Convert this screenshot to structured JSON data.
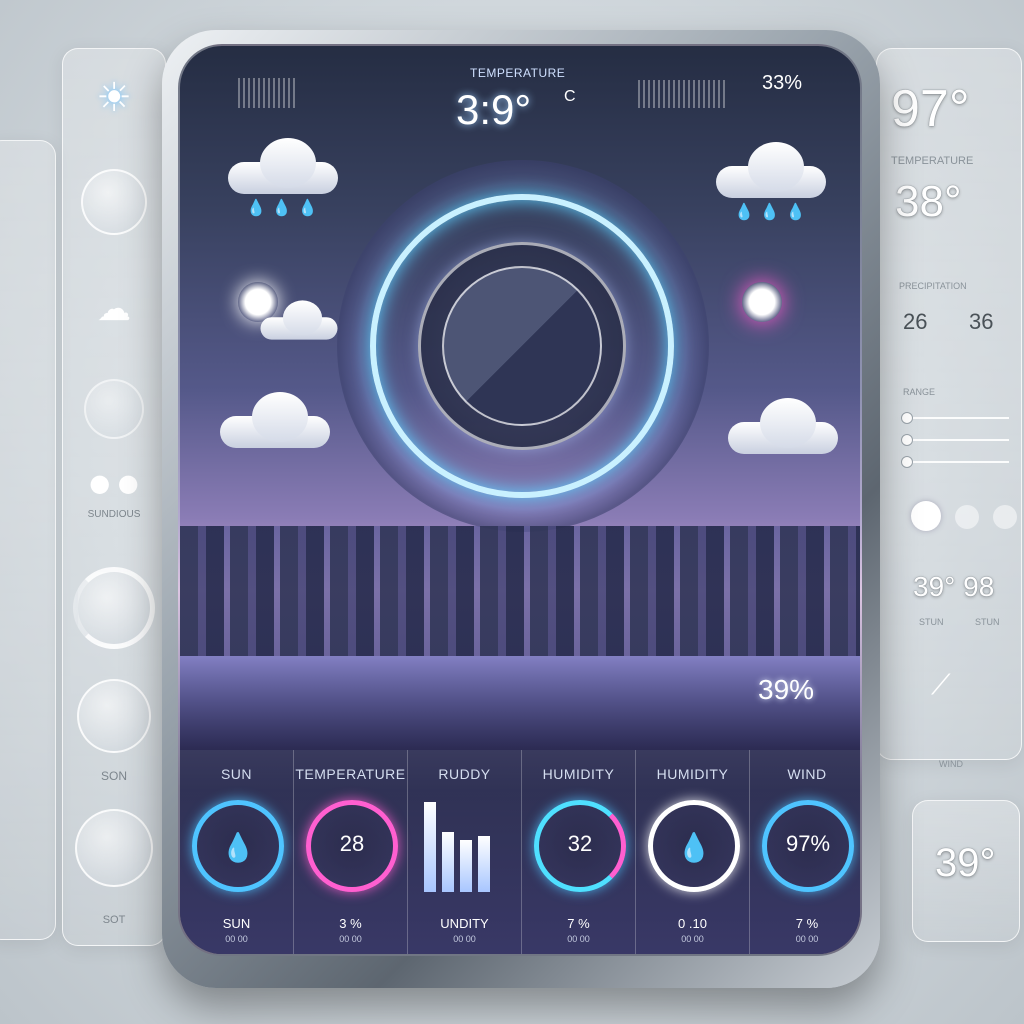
{
  "left_panel": {
    "side_label_1": "SON",
    "side_label_2": "SOT",
    "caption": "SUNDIOUS"
  },
  "right_panel": {
    "temp_top": "97°",
    "temperature_label": "TEMPERATURE",
    "temp_main": "38°",
    "small_label": "PRECIPITATION",
    "stat_a": "26",
    "stat_b": "36",
    "range_label": "RANGE",
    "pair_value": "39° 98",
    "pair_label_a": "STUN",
    "pair_label_b": "STUN",
    "wind_label": "WIND",
    "card_temp": "39°"
  },
  "screen": {
    "header_label": "TEMPERATURE",
    "header_temp": "3:9°",
    "header_unit": "C",
    "header_percent": "33%",
    "city_readout": "39%"
  },
  "stats": [
    {
      "label": "SUN",
      "value": "",
      "sub": "SUN",
      "sub2": "00 00"
    },
    {
      "label": "TEMPERATURE",
      "value": "28",
      "sub": "3 %",
      "sub2": "00 00"
    },
    {
      "label": "RUDDY",
      "value": "",
      "sub": "UNDITY",
      "sub2": "00 00"
    },
    {
      "label": "HUMIDITY",
      "value": "32",
      "sub": "7 %",
      "sub2": "00 00"
    },
    {
      "label": "HUMIDITY",
      "value": "",
      "sub": "0 .10",
      "sub2": "00 00"
    },
    {
      "label": "WIND",
      "value": "97%",
      "sub": "7 %",
      "sub2": "00 00"
    }
  ],
  "colors": {
    "accent_cyan": "#4fc4ff",
    "accent_pink": "#ff5fd0",
    "ring": "#c9f1ff"
  },
  "icons": [
    "sun-icon",
    "cloud-rain-icon",
    "partly-cloudy-icon",
    "raindrop-icon",
    "wind-icon"
  ]
}
